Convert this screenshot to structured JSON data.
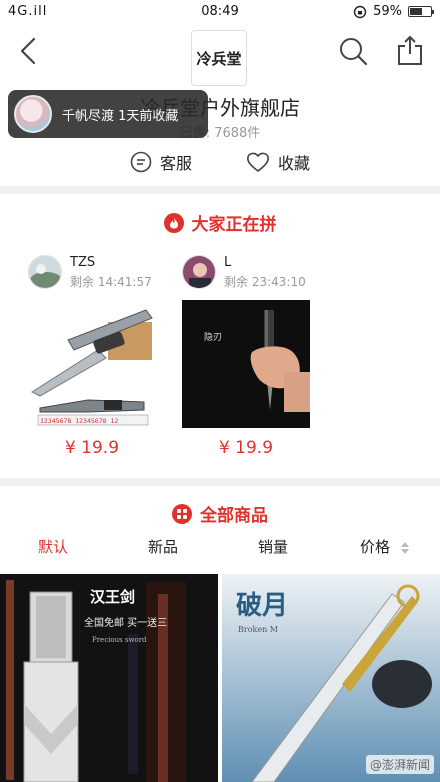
{
  "status_bar": {
    "signal": "4G.ill",
    "time": "08:49",
    "battery_text": "59%",
    "battery_level": 0.59
  },
  "nav": {
    "logo_text": "冷兵堂",
    "icons": [
      "back-icon",
      "search-icon",
      "share-icon"
    ]
  },
  "shop": {
    "name": "冷兵堂户外旗舰店",
    "sub_text": "已售: 7688件",
    "service_label": "客服",
    "favorite_label": "收藏"
  },
  "toast": {
    "text": "千帆尽渡 1天前收藏"
  },
  "group_buy": {
    "title": "大家正在拼",
    "items": [
      {
        "user": "TZS",
        "remaining": "剩余 14:41:57",
        "price": "¥ 19.9"
      },
      {
        "user": "L",
        "remaining": "剩余 23:43:10",
        "price": "¥ 19.9"
      }
    ]
  },
  "all_goods": {
    "title": "全部商品",
    "tabs": [
      "默认",
      "新品",
      "销量",
      "价格"
    ],
    "active_tab": "默认"
  },
  "images": {
    "knife_ruler_text": "12345678 12345678 12",
    "dagger_caption": "隐刃",
    "sword_banner_brand": "汉王剑",
    "sword_banner_line": "全国免邮 买一送三",
    "sword_banner_en": "Precious sword",
    "moon_title": "破月",
    "moon_en": "Broken M"
  },
  "watermark": "@澎湃新闻",
  "colors": {
    "accent": "#e0322b",
    "muted": "#999999",
    "divider": "#f1f1f1"
  }
}
